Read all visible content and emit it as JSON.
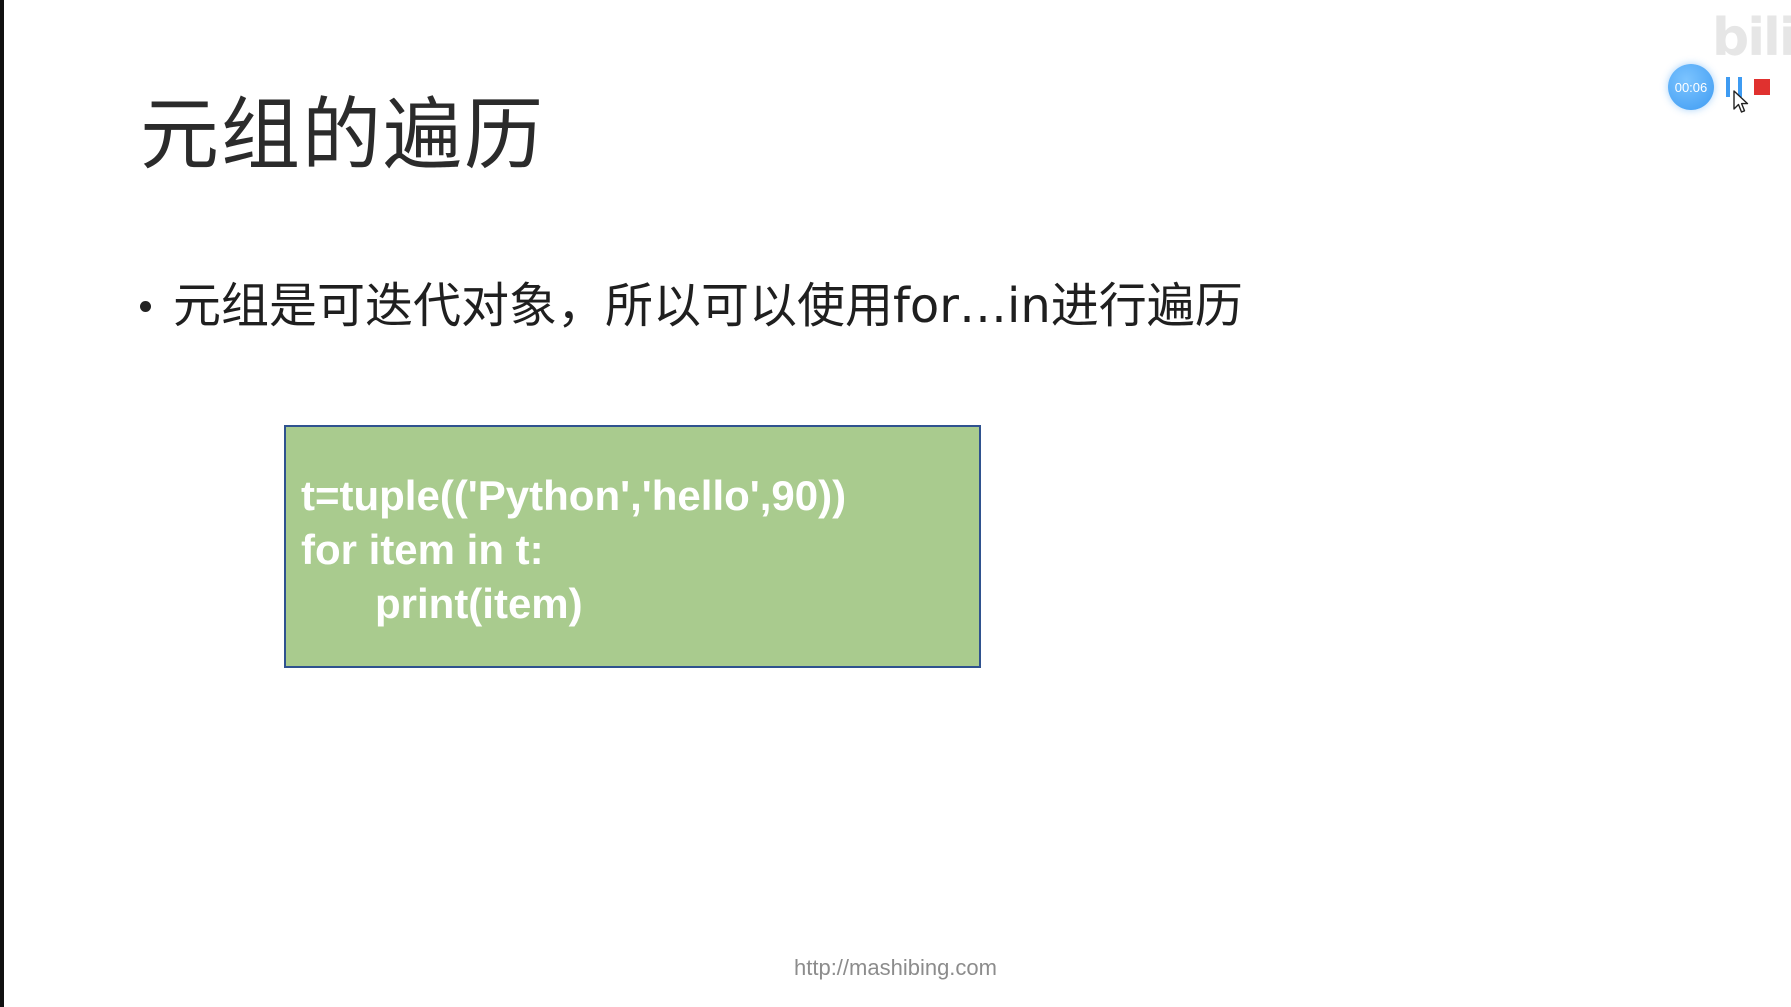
{
  "slide": {
    "title": "元组的遍历",
    "bullet": "元组是可迭代对象，所以可以使用for…in进行遍历",
    "code_lines": [
      "t=tuple(('Python','hello',90))",
      "for item in t:",
      "print(item)"
    ],
    "footer_url": "http://mashibing.com"
  },
  "recorder": {
    "timer": "00:06",
    "pause_icon": "pause-icon",
    "stop_icon": "stop-icon"
  },
  "watermark": {
    "text": "bili"
  },
  "colors": {
    "code_box_fill": "#a9cb8e",
    "code_box_border": "#2f528f",
    "timer_blue": "#3e9bf2",
    "stop_red": "#e0312f"
  }
}
